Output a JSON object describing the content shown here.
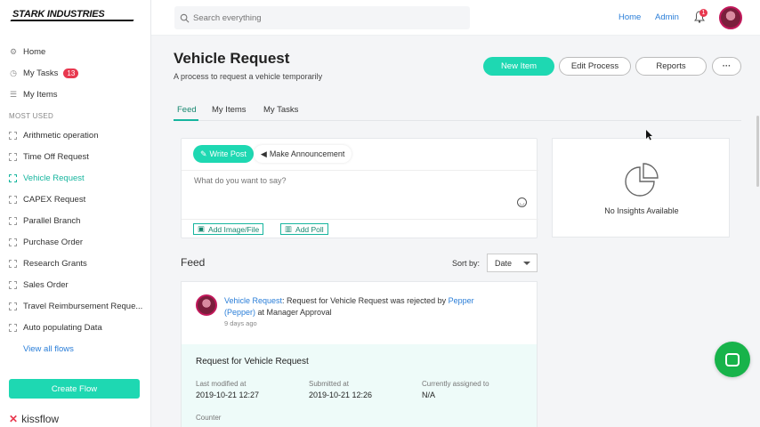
{
  "sidebar": {
    "logo": "STARK INDUSTRIES",
    "nav": [
      {
        "label": "Home",
        "icon": "gear-icon"
      },
      {
        "label": "My Tasks",
        "icon": "clock-icon",
        "badge": "13"
      },
      {
        "label": "My Items",
        "icon": "list-icon"
      }
    ],
    "section_label": "MOST USED",
    "flows": [
      {
        "label": "Arithmetic operation"
      },
      {
        "label": "Time Off Request"
      },
      {
        "label": "Vehicle Request",
        "active": true
      },
      {
        "label": "CAPEX Request"
      },
      {
        "label": "Parallel Branch"
      },
      {
        "label": "Purchase Order"
      },
      {
        "label": "Research Grants"
      },
      {
        "label": "Sales Order"
      },
      {
        "label": "Travel Reimbursement Reque..."
      },
      {
        "label": "Auto populating Data"
      }
    ],
    "view_all": "View all flows",
    "create_flow": "Create Flow",
    "brand": "kissflow"
  },
  "topbar": {
    "search_placeholder": "Search everything",
    "home": "Home",
    "admin": "Admin",
    "notification_count": "1"
  },
  "header": {
    "title": "Vehicle Request",
    "subtitle": "A process to request a vehicle temporarily",
    "new_item": "New Item",
    "edit_process": "Edit Process",
    "reports": "Reports",
    "more": "···"
  },
  "tabs": [
    "Feed",
    "My Items",
    "My Tasks"
  ],
  "post": {
    "write_post": "Write Post",
    "make_announcement": "Make Announcement",
    "placeholder": "What do you want to say?",
    "add_image": "Add Image/File",
    "add_poll": "Add Poll"
  },
  "insights": {
    "text": "No Insights Available"
  },
  "feed": {
    "title": "Feed",
    "sort_label": "Sort by:",
    "sort_value": "Date",
    "item": {
      "link": "Vehicle Request",
      "text1": ": Request for Vehicle Request was rejected by ",
      "user": "Pepper (Pepper)",
      "text2": " at Manager Approval",
      "time": "9 days ago",
      "detail_title": "Request for Vehicle Request",
      "last_modified_label": "Last modified at",
      "last_modified_value": "2019-10-21 12:27",
      "submitted_label": "Submitted at",
      "submitted_value": "2019-10-21 12:26",
      "assigned_label": "Currently assigned to",
      "assigned_value": "N/A",
      "counter_label": "Counter"
    }
  },
  "colors": {
    "accent": "#1ed8b2",
    "link": "#2a7ed8",
    "badge": "#e8384f",
    "chat": "#17b34a"
  }
}
